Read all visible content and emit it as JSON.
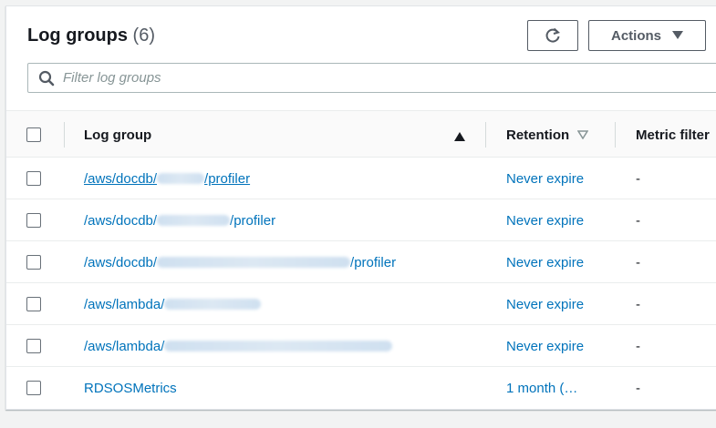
{
  "header": {
    "title": "Log groups",
    "count": "(6)",
    "refresh_icon": "refresh-icon",
    "actions_label": "Actions",
    "actions_icon": "caret-down-icon"
  },
  "search": {
    "placeholder": "Filter log groups",
    "icon": "search-icon"
  },
  "table": {
    "columns": {
      "log_group": "Log group",
      "retention": "Retention",
      "metric_filters": "Metric filter"
    },
    "sort": {
      "log_group_icon": "sort-ascending-icon",
      "retention_icon": "sort-descending-icon"
    },
    "rows": [
      {
        "prefix": "/aws/docdb/",
        "suffix": "/profiler",
        "retention": "Never expire",
        "metric_filters": "-"
      },
      {
        "prefix": "/aws/docdb/",
        "suffix": "/profiler",
        "retention": "Never expire",
        "metric_filters": "-"
      },
      {
        "prefix": "/aws/docdb/",
        "suffix": "/profiler",
        "retention": "Never expire",
        "metric_filters": "-"
      },
      {
        "prefix": "/aws/lambda/",
        "suffix": "",
        "retention": "Never expire",
        "metric_filters": "-"
      },
      {
        "prefix": "/aws/lambda/",
        "suffix": "",
        "retention": "Never expire",
        "metric_filters": "-"
      },
      {
        "prefix": "RDSOSMetrics",
        "suffix": "",
        "retention": "1 month (…",
        "metric_filters": "-"
      }
    ]
  },
  "colors": {
    "link": "#0073bb",
    "text": "#16191f",
    "border": "#eaeded"
  }
}
